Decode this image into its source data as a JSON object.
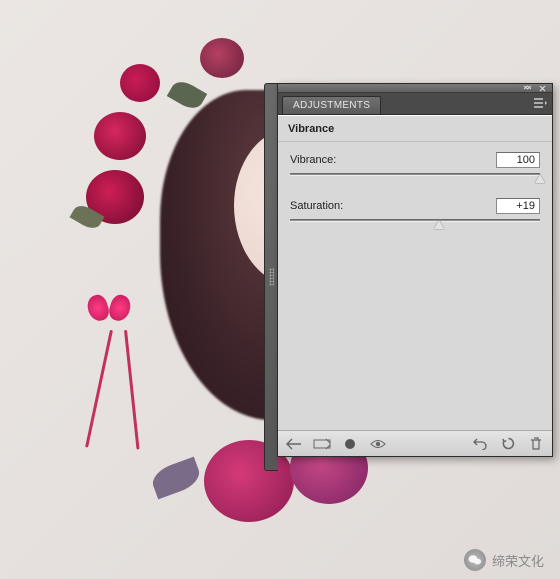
{
  "panel": {
    "tab_label": "ADJUSTMENTS",
    "title": "Vibrance",
    "sliders": {
      "vibrance": {
        "label": "Vibrance:",
        "value": "100",
        "percent": 100
      },
      "saturation": {
        "label": "Saturation:",
        "value": "+19",
        "percent": 59.5
      }
    }
  },
  "watermark": {
    "text": "缔荣文化"
  }
}
